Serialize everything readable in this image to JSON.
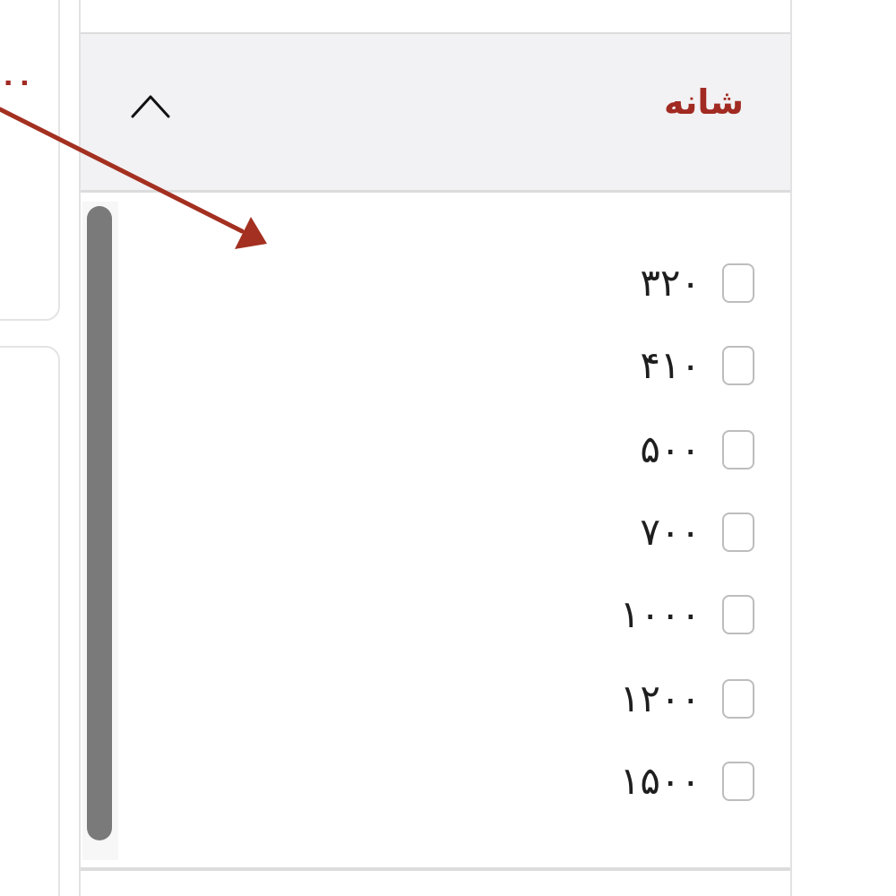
{
  "left_panel": {
    "price_text": "۰۰"
  },
  "filter": {
    "title": "شانه",
    "chevron_icon": "chevron-up-icon",
    "options": [
      {
        "label": "۳۲۰",
        "checked": false
      },
      {
        "label": "۴۱۰",
        "checked": false
      },
      {
        "label": "۵۰۰",
        "checked": false
      },
      {
        "label": "۷۰۰",
        "checked": false
      },
      {
        "label": "۱۰۰۰",
        "checked": false
      },
      {
        "label": "۱۲۰۰",
        "checked": false
      },
      {
        "label": "۱۵۰۰",
        "checked": false
      }
    ]
  },
  "colors": {
    "accent": "#a12a22",
    "header_bg": "#f2f1f3",
    "scroll_thumb": "#7a7a7a",
    "checkbox_border": "#bdbdbd"
  }
}
